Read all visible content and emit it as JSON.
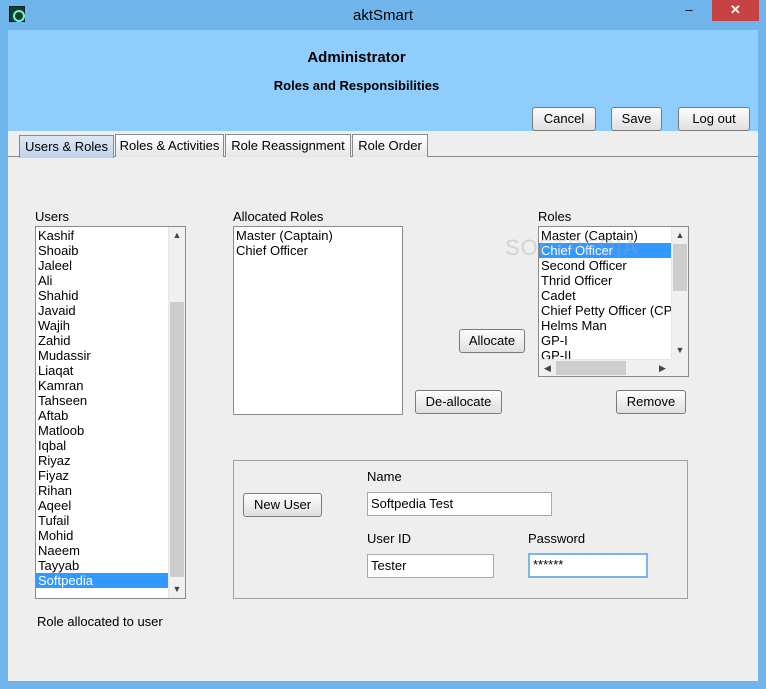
{
  "window": {
    "title": "aktSmart",
    "minimize_label": "–",
    "maximize_label": "□",
    "close_label": "✕"
  },
  "header": {
    "title": "Administrator",
    "subtitle": "Roles and Responsibilities",
    "cancel_label": "Cancel",
    "save_label": "Save",
    "logout_label": "Log out"
  },
  "tabs": [
    {
      "label": "Users & Roles",
      "active": true
    },
    {
      "label": "Roles & Activities",
      "active": false
    },
    {
      "label": "Role Reassignment",
      "active": false
    },
    {
      "label": "Role Order",
      "active": false
    }
  ],
  "users": {
    "label": "Users",
    "items": [
      "Kashif",
      "Shoaib",
      "Jaleel",
      "Ali",
      "Shahid",
      "Javaid",
      "Wajih",
      "Zahid",
      "Mudassir",
      "Liaqat",
      "Kamran",
      "Tahseen",
      "Aftab",
      "Matloob",
      "Iqbal",
      "Riyaz",
      "Fiyaz",
      "Rihan",
      "Aqeel",
      "Tufail",
      "Mohid",
      "Naeem",
      "Tayyab",
      "Softpedia"
    ],
    "selected": "Softpedia"
  },
  "allocated_roles": {
    "label": "Allocated Roles",
    "items": [
      "Master (Captain)",
      "Chief Officer"
    ]
  },
  "roles": {
    "label": "Roles",
    "items": [
      "Master (Captain)",
      "Chief Officer",
      "Second Officer",
      "Thrid Officer",
      "Cadet",
      "Chief Petty Officer (CPO",
      "Helms Man",
      "GP-I",
      "GP-II"
    ],
    "selected": "Chief Officer"
  },
  "actions": {
    "allocate_label": "Allocate",
    "deallocate_label": "De-allocate",
    "remove_label": "Remove"
  },
  "new_user": {
    "button_label": "New User",
    "name_label": "Name",
    "name_value": "Softpedia Test",
    "userid_label": "User ID",
    "userid_value": "Tester",
    "password_label": "Password",
    "password_value": "******"
  },
  "status": {
    "text": "Role allocated to user"
  },
  "watermark": "SOFTPEDIA",
  "icons": {
    "scroll_up": "▲",
    "scroll_down": "▼",
    "scroll_left": "◀",
    "scroll_right": "▶"
  }
}
